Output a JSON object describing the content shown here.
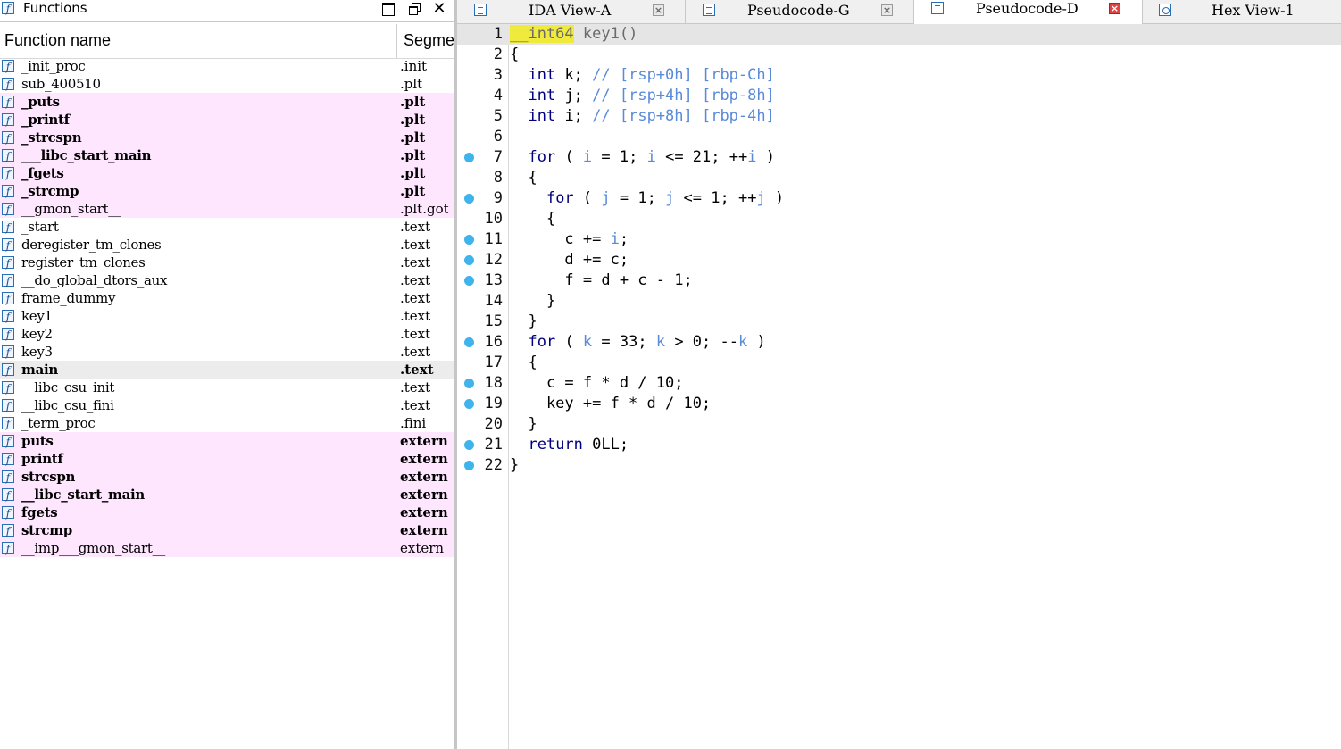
{
  "functions_panel": {
    "title": "Functions",
    "col_name": "Function name",
    "col_segment": "Segment",
    "rows": [
      {
        "name": "_init_proc",
        "segment": ".init",
        "style": "normal"
      },
      {
        "name": "sub_400510",
        "segment": ".plt",
        "style": "normal"
      },
      {
        "name": "_puts",
        "segment": ".plt",
        "style": "pink-bold"
      },
      {
        "name": "_printf",
        "segment": ".plt",
        "style": "pink-bold"
      },
      {
        "name": "_strcspn",
        "segment": ".plt",
        "style": "pink-bold"
      },
      {
        "name": "___libc_start_main",
        "segment": ".plt",
        "style": "pink-bold"
      },
      {
        "name": "_fgets",
        "segment": ".plt",
        "style": "pink-bold"
      },
      {
        "name": "_strcmp",
        "segment": ".plt",
        "style": "pink-bold"
      },
      {
        "name": "__gmon_start__",
        "segment": ".plt.got",
        "style": "pink"
      },
      {
        "name": "_start",
        "segment": ".text",
        "style": "normal"
      },
      {
        "name": "deregister_tm_clones",
        "segment": ".text",
        "style": "normal"
      },
      {
        "name": "register_tm_clones",
        "segment": ".text",
        "style": "normal"
      },
      {
        "name": "__do_global_dtors_aux",
        "segment": ".text",
        "style": "normal"
      },
      {
        "name": "frame_dummy",
        "segment": ".text",
        "style": "normal"
      },
      {
        "name": "key1",
        "segment": ".text",
        "style": "normal"
      },
      {
        "name": "key2",
        "segment": ".text",
        "style": "normal"
      },
      {
        "name": "key3",
        "segment": ".text",
        "style": "normal"
      },
      {
        "name": "main",
        "segment": ".text",
        "style": "selected-bold"
      },
      {
        "name": "__libc_csu_init",
        "segment": ".text",
        "style": "normal"
      },
      {
        "name": "__libc_csu_fini",
        "segment": ".text",
        "style": "normal"
      },
      {
        "name": "_term_proc",
        "segment": ".fini",
        "style": "normal"
      },
      {
        "name": "puts",
        "segment": "extern",
        "style": "pink-bold"
      },
      {
        "name": "printf",
        "segment": "extern",
        "style": "pink-bold"
      },
      {
        "name": "strcspn",
        "segment": "extern",
        "style": "pink-bold"
      },
      {
        "name": "__libc_start_main",
        "segment": "extern",
        "style": "pink-bold"
      },
      {
        "name": "fgets",
        "segment": "extern",
        "style": "pink-bold"
      },
      {
        "name": "strcmp",
        "segment": "extern",
        "style": "pink-bold"
      },
      {
        "name": "__imp___gmon_start__",
        "segment": "extern",
        "style": "pink"
      }
    ]
  },
  "tabs": [
    {
      "label": "IDA View-A",
      "icon": "disassembly-icon",
      "close": "gray",
      "active": false
    },
    {
      "label": "Pseudocode-G",
      "icon": "pseudocode-icon",
      "close": "gray",
      "active": false
    },
    {
      "label": "Pseudocode-D",
      "icon": "pseudocode-icon",
      "close": "red",
      "active": true
    },
    {
      "label": "Hex View-1",
      "icon": "hex-icon",
      "close": "none",
      "active": false
    }
  ],
  "code": {
    "current_line": 1,
    "lines": [
      {
        "n": "1",
        "bp": false,
        "tokens": [
          [
            "hl",
            "__int64"
          ],
          [
            "gray",
            " key1()"
          ]
        ]
      },
      {
        "n": "2",
        "bp": false,
        "tokens": [
          [
            "p",
            "{"
          ]
        ]
      },
      {
        "n": "3",
        "bp": false,
        "tokens": [
          [
            "p",
            "  int k; "
          ],
          [
            "cmt",
            "// [rsp+0h] [rbp-Ch]"
          ]
        ]
      },
      {
        "n": "4",
        "bp": false,
        "tokens": [
          [
            "p",
            "  int j; "
          ],
          [
            "cmt",
            "// [rsp+4h] [rbp-8h]"
          ]
        ]
      },
      {
        "n": "5",
        "bp": false,
        "tokens": [
          [
            "p",
            "  int i; "
          ],
          [
            "cmt",
            "// [rsp+8h] [rbp-4h]"
          ]
        ]
      },
      {
        "n": "6",
        "bp": false,
        "tokens": []
      },
      {
        "n": "7",
        "bp": true,
        "tokens": [
          [
            "p",
            "  for ( "
          ],
          [
            "var",
            "i"
          ],
          [
            "p",
            " = 1; "
          ],
          [
            "var",
            "i"
          ],
          [
            "p",
            " <= 21; ++"
          ],
          [
            "var",
            "i"
          ],
          [
            "p",
            " )"
          ]
        ]
      },
      {
        "n": "8",
        "bp": false,
        "tokens": [
          [
            "p",
            "  {"
          ]
        ]
      },
      {
        "n": "9",
        "bp": true,
        "tokens": [
          [
            "p",
            "    for ( "
          ],
          [
            "var",
            "j"
          ],
          [
            "p",
            " = 1; "
          ],
          [
            "var",
            "j"
          ],
          [
            "p",
            " <= 1; ++"
          ],
          [
            "var",
            "j"
          ],
          [
            "p",
            " )"
          ]
        ]
      },
      {
        "n": "10",
        "bp": false,
        "tokens": [
          [
            "p",
            "    {"
          ]
        ]
      },
      {
        "n": "11",
        "bp": true,
        "tokens": [
          [
            "p",
            "      c += "
          ],
          [
            "var",
            "i"
          ],
          [
            "p",
            ";"
          ]
        ]
      },
      {
        "n": "12",
        "bp": true,
        "tokens": [
          [
            "p",
            "      d += c;"
          ]
        ]
      },
      {
        "n": "13",
        "bp": true,
        "tokens": [
          [
            "p",
            "      f = d + c - 1;"
          ]
        ]
      },
      {
        "n": "14",
        "bp": false,
        "tokens": [
          [
            "p",
            "    }"
          ]
        ]
      },
      {
        "n": "15",
        "bp": false,
        "tokens": [
          [
            "p",
            "  }"
          ]
        ]
      },
      {
        "n": "16",
        "bp": true,
        "tokens": [
          [
            "p",
            "  for ( "
          ],
          [
            "var",
            "k"
          ],
          [
            "p",
            " = 33; "
          ],
          [
            "var",
            "k"
          ],
          [
            "p",
            " > 0; --"
          ],
          [
            "var",
            "k"
          ],
          [
            "p",
            " )"
          ]
        ]
      },
      {
        "n": "17",
        "bp": false,
        "tokens": [
          [
            "p",
            "  {"
          ]
        ]
      },
      {
        "n": "18",
        "bp": true,
        "tokens": [
          [
            "p",
            "    c = f * d / 10;"
          ]
        ]
      },
      {
        "n": "19",
        "bp": true,
        "tokens": [
          [
            "p",
            "    key += f * d / 10;"
          ]
        ]
      },
      {
        "n": "20",
        "bp": false,
        "tokens": [
          [
            "p",
            "  }"
          ]
        ]
      },
      {
        "n": "21",
        "bp": true,
        "tokens": [
          [
            "p",
            "  return 0LL;"
          ]
        ]
      },
      {
        "n": "22",
        "bp": true,
        "tokens": [
          [
            "p",
            "}"
          ]
        ]
      }
    ]
  }
}
